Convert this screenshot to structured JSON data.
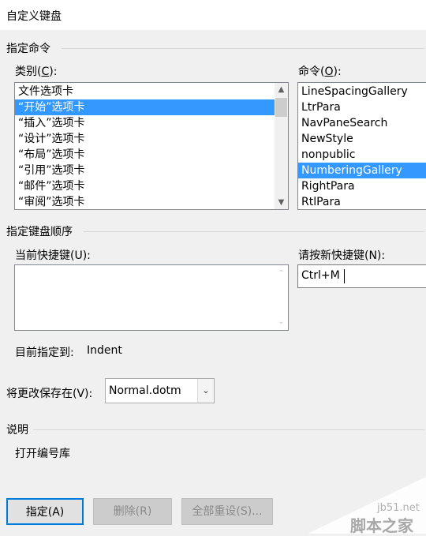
{
  "dialog": {
    "title": "自定义键盘"
  },
  "commands_section": {
    "heading": "指定命令",
    "categories_label": "类别(C):",
    "categories_label_key": "C",
    "commands_label": "命令(O):",
    "commands_label_key": "O",
    "categories": [
      "文件选项卡",
      "“开始”选项卡",
      "“插入”选项卡",
      "“设计”选项卡",
      "“布局”选项卡",
      "“引用”选项卡",
      "“邮件”选项卡",
      "“审阅”选项卡"
    ],
    "categories_selected": "“开始”选项卡",
    "commands": [
      "LineSpacingGallery",
      "LtrPara",
      "NavPaneSearch",
      "NewStyle",
      "nonpublic",
      "NumberingGallery",
      "RightPara",
      "RtlPara"
    ],
    "commands_selected": "NumberingGallery"
  },
  "keyboard_section": {
    "heading": "指定键盘顺序",
    "current_keys_label": "当前快捷键(U):",
    "new_key_label": "请按新快捷键(N):",
    "new_key_value": "Ctrl+M",
    "assigned_to_label": "目前指定到:",
    "assigned_to_value": "Indent"
  },
  "save_in": {
    "label": "将更改保存在(V):",
    "value": "Normal.dotm"
  },
  "description": {
    "heading": "说明",
    "text": "打开编号库"
  },
  "buttons": {
    "assign": "指定(A)",
    "remove": "删除(R)",
    "reset_all": "全部重设(S)..."
  },
  "watermark": {
    "site": "jb51.net",
    "name": "脚本之家"
  }
}
